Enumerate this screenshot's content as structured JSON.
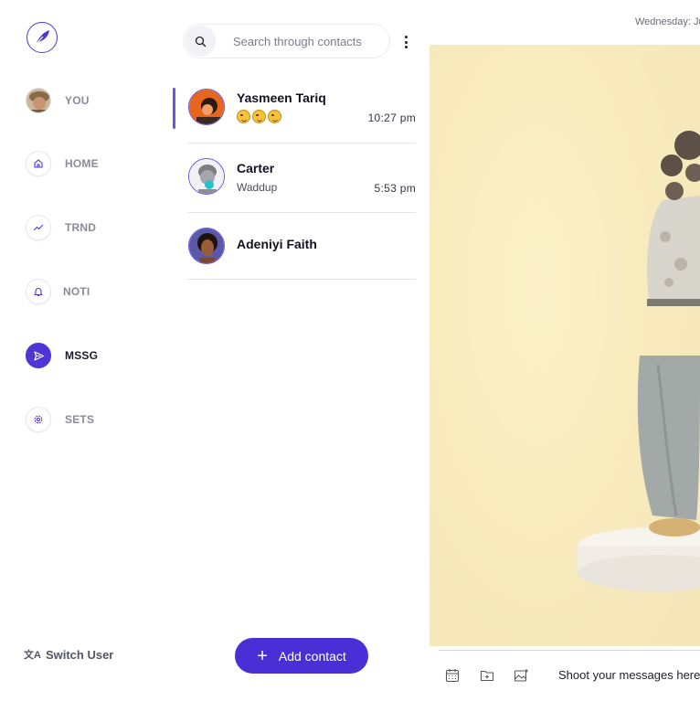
{
  "app": {
    "logo_icon": "feather-icon",
    "accent_color": "#4a2fd6"
  },
  "nav": {
    "items": [
      {
        "key": "you",
        "label": "YOU",
        "icon": "user-avatar"
      },
      {
        "key": "home",
        "label": "HOME",
        "icon": "home-icon"
      },
      {
        "key": "trnd",
        "label": "TRND",
        "icon": "trend-icon"
      },
      {
        "key": "noti",
        "label": "NOTI",
        "icon": "bell-icon"
      },
      {
        "key": "mssg",
        "label": "MSSG",
        "icon": "send-icon",
        "active": true
      },
      {
        "key": "sets",
        "label": "SETS",
        "icon": "gear-icon"
      }
    ],
    "switch_user": "Switch User"
  },
  "contacts": {
    "search_placeholder": "Search through contacts",
    "list": [
      {
        "name": "Yasmeen Tariq",
        "preview": "😏😏😏",
        "time": "10:27 pm",
        "active": true
      },
      {
        "name": "Carter",
        "preview": "Waddup",
        "time": "5:53 pm"
      },
      {
        "name": "Adeniyi Faith",
        "preview": "",
        "time": ""
      }
    ],
    "add_label": "Add contact"
  },
  "chat": {
    "date": "Wednesday: Ju",
    "message_placeholder": "Shoot your messages here..."
  }
}
